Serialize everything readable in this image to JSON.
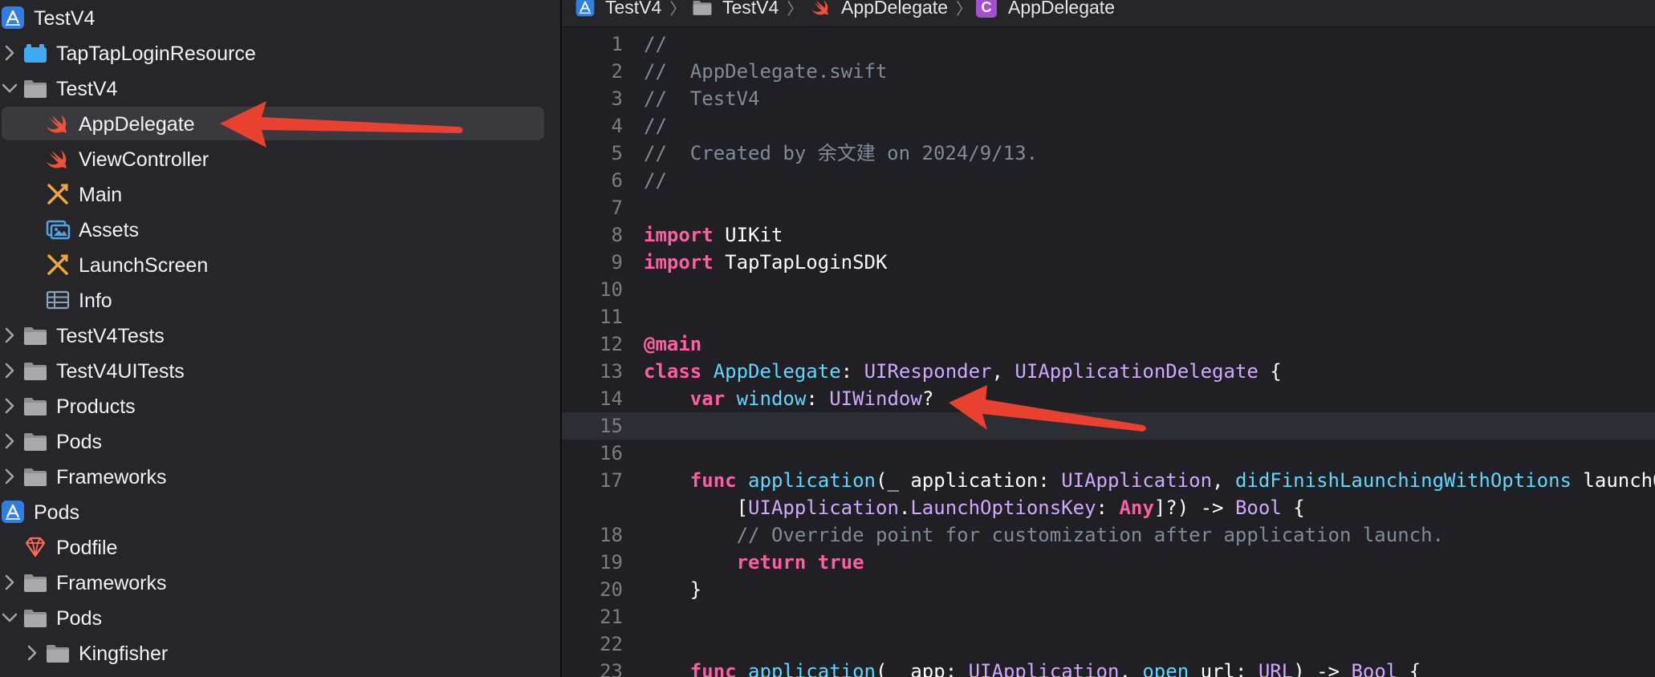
{
  "navigator": {
    "items": [
      {
        "label": "TestV4",
        "icon": "xcode-project-icon",
        "indent": 0,
        "chevron": "none",
        "selected": false
      },
      {
        "label": "TapTapLoginResource",
        "icon": "bundle-icon",
        "indent": 1,
        "chevron": "right",
        "selected": false
      },
      {
        "label": "TestV4",
        "icon": "folder-icon",
        "indent": 1,
        "chevron": "down",
        "selected": false
      },
      {
        "label": "AppDelegate",
        "icon": "swift-icon",
        "indent": 2,
        "chevron": "none",
        "selected": true
      },
      {
        "label": "ViewController",
        "icon": "swift-icon",
        "indent": 2,
        "chevron": "none",
        "selected": false
      },
      {
        "label": "Main",
        "icon": "storyboard-icon",
        "indent": 2,
        "chevron": "none",
        "selected": false
      },
      {
        "label": "Assets",
        "icon": "asset-catalog-icon",
        "indent": 2,
        "chevron": "none",
        "selected": false
      },
      {
        "label": "LaunchScreen",
        "icon": "storyboard-icon",
        "indent": 2,
        "chevron": "none",
        "selected": false
      },
      {
        "label": "Info",
        "icon": "plist-table-icon",
        "indent": 2,
        "chevron": "none",
        "selected": false
      },
      {
        "label": "TestV4Tests",
        "icon": "folder-icon",
        "indent": 1,
        "chevron": "right",
        "selected": false
      },
      {
        "label": "TestV4UITests",
        "icon": "folder-icon",
        "indent": 1,
        "chevron": "right",
        "selected": false
      },
      {
        "label": "Products",
        "icon": "folder-icon",
        "indent": 1,
        "chevron": "right",
        "selected": false
      },
      {
        "label": "Pods",
        "icon": "folder-icon",
        "indent": 1,
        "chevron": "right",
        "selected": false
      },
      {
        "label": "Frameworks",
        "icon": "folder-icon",
        "indent": 1,
        "chevron": "right",
        "selected": false
      },
      {
        "label": "Pods",
        "icon": "xcode-project-icon",
        "indent": 0,
        "chevron": "none",
        "selected": false
      },
      {
        "label": "Podfile",
        "icon": "ruby-gem-icon",
        "indent": 1,
        "chevron": "none",
        "selected": false
      },
      {
        "label": "Frameworks",
        "icon": "folder-icon",
        "indent": 1,
        "chevron": "right",
        "selected": false
      },
      {
        "label": "Pods",
        "icon": "folder-icon",
        "indent": 1,
        "chevron": "down",
        "selected": false
      },
      {
        "label": "Kingfisher",
        "icon": "folder-icon",
        "indent": 2,
        "chevron": "right",
        "selected": false
      }
    ]
  },
  "jumpbar": {
    "crumbs": [
      {
        "label": "TestV4",
        "icon": "xcode-project-icon"
      },
      {
        "label": "TestV4",
        "icon": "folder-icon"
      },
      {
        "label": "AppDelegate",
        "icon": "swift-icon"
      },
      {
        "label": "AppDelegate",
        "icon": "class-icon",
        "badge": "C"
      }
    ],
    "separator": "〉"
  },
  "editor": {
    "current_line": 15,
    "lines": [
      {
        "n": "1",
        "tokens": [
          [
            "comment",
            "//"
          ]
        ]
      },
      {
        "n": "2",
        "tokens": [
          [
            "comment",
            "//  AppDelegate.swift"
          ]
        ]
      },
      {
        "n": "3",
        "tokens": [
          [
            "comment",
            "//  TestV4"
          ]
        ]
      },
      {
        "n": "4",
        "tokens": [
          [
            "comment",
            "//"
          ]
        ]
      },
      {
        "n": "5",
        "tokens": [
          [
            "comment",
            "//  Created by 余文建 on 2024/9/13."
          ]
        ]
      },
      {
        "n": "6",
        "tokens": [
          [
            "comment",
            "//"
          ]
        ]
      },
      {
        "n": "7",
        "tokens": []
      },
      {
        "n": "8",
        "tokens": [
          [
            "kw",
            "import"
          ],
          [
            "plain",
            " UIKit"
          ]
        ]
      },
      {
        "n": "9",
        "tokens": [
          [
            "kw",
            "import"
          ],
          [
            "plain",
            " TapTapLoginSDK"
          ]
        ]
      },
      {
        "n": "10",
        "tokens": []
      },
      {
        "n": "11",
        "tokens": []
      },
      {
        "n": "12",
        "tokens": [
          [
            "kw",
            "@main"
          ]
        ]
      },
      {
        "n": "13",
        "tokens": [
          [
            "kw",
            "class"
          ],
          [
            "plain",
            " "
          ],
          [
            "decl",
            "AppDelegate"
          ],
          [
            "plain",
            ": "
          ],
          [
            "type",
            "UIResponder"
          ],
          [
            "plain",
            ", "
          ],
          [
            "type",
            "UIApplicationDelegate"
          ],
          [
            "plain",
            " {"
          ]
        ]
      },
      {
        "n": "14",
        "tokens": [
          [
            "plain",
            "    "
          ],
          [
            "kw",
            "var"
          ],
          [
            "plain",
            " "
          ],
          [
            "decl",
            "window"
          ],
          [
            "plain",
            ": "
          ],
          [
            "type",
            "UIWindow"
          ],
          [
            "plain",
            "?"
          ]
        ]
      },
      {
        "n": "15",
        "tokens": []
      },
      {
        "n": "16",
        "tokens": []
      },
      {
        "n": "17",
        "tokens": [
          [
            "plain",
            "    "
          ],
          [
            "kw",
            "func"
          ],
          [
            "plain",
            " "
          ],
          [
            "decl",
            "application"
          ],
          [
            "plain",
            "(_ application: "
          ],
          [
            "type",
            "UIApplication"
          ],
          [
            "plain",
            ", "
          ],
          [
            "decl",
            "didFinishLaunchingWithOptions"
          ],
          [
            "plain",
            " launchOptions:"
          ]
        ]
      },
      {
        "n": "",
        "tokens": [
          [
            "plain",
            "        ["
          ],
          [
            "type",
            "UIApplication"
          ],
          [
            "plain",
            "."
          ],
          [
            "type",
            "LaunchOptionsKey"
          ],
          [
            "plain",
            ": "
          ],
          [
            "kw",
            "Any"
          ],
          [
            "plain",
            "]?) -> "
          ],
          [
            "type",
            "Bool"
          ],
          [
            "plain",
            " {"
          ]
        ]
      },
      {
        "n": "18",
        "tokens": [
          [
            "plain",
            "        "
          ],
          [
            "comment",
            "// Override point for customization after application launch."
          ]
        ]
      },
      {
        "n": "19",
        "tokens": [
          [
            "plain",
            "        "
          ],
          [
            "kw",
            "return"
          ],
          [
            "plain",
            " "
          ],
          [
            "kw",
            "true"
          ]
        ]
      },
      {
        "n": "20",
        "tokens": [
          [
            "plain",
            "    }"
          ]
        ]
      },
      {
        "n": "21",
        "tokens": []
      },
      {
        "n": "22",
        "tokens": []
      },
      {
        "n": "23",
        "tokens": [
          [
            "plain",
            "    "
          ],
          [
            "kw",
            "func"
          ],
          [
            "plain",
            " "
          ],
          [
            "decl",
            "application"
          ],
          [
            "plain",
            "(_ app: "
          ],
          [
            "type",
            "UIApplication"
          ],
          [
            "plain",
            ", "
          ],
          [
            "decl",
            "open"
          ],
          [
            "plain",
            " url: "
          ],
          [
            "type",
            "URL"
          ],
          [
            "plain",
            ") -> "
          ],
          [
            "type",
            "Bool"
          ],
          [
            "plain",
            " {"
          ]
        ]
      }
    ]
  },
  "colors": {
    "navigator_bg": "#262629",
    "editor_bg": "#1f1f24",
    "selection": "#3a3a3e",
    "keyword": "#fc5fa3",
    "declaration": "#5dd8ff",
    "type": "#d0a8ff",
    "comment": "#7f8c98",
    "annotation_arrow": "#e8412f",
    "folder": "#8e8e93",
    "swift": "#f05138"
  }
}
